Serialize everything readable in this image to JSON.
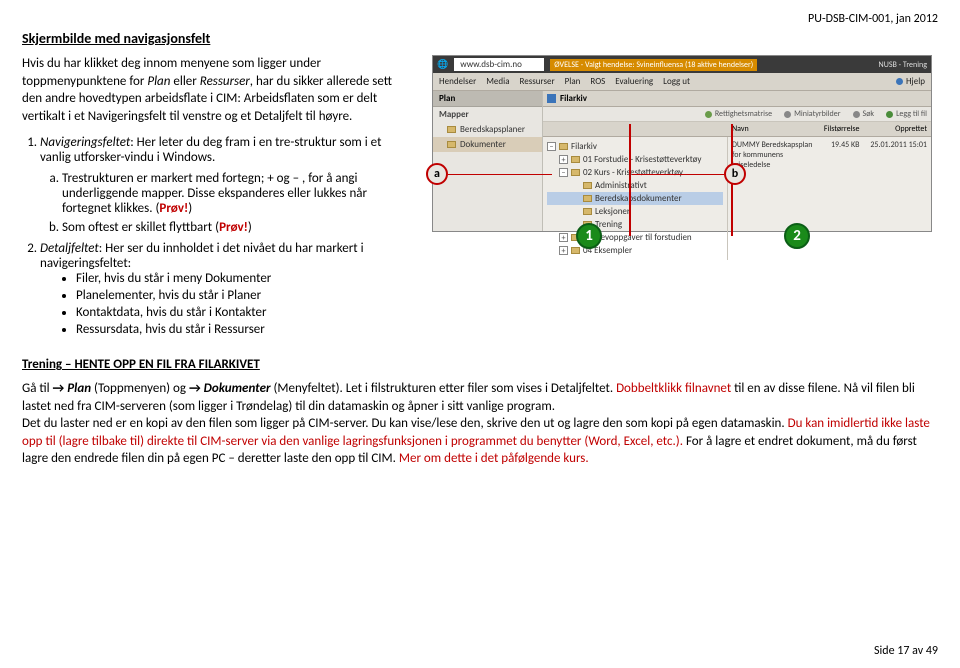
{
  "header": {
    "doc_id": "PU-DSB-CIM-001, jan 2012"
  },
  "section_title": "Skjermbilde med navigasjonsfelt",
  "intro": {
    "p1a": "Hvis du har klikket deg innom menyene som ligger under toppmenypunktene for ",
    "p1_plan": "Plan",
    "p1b": " eller ",
    "p1_ress": "Ressurser",
    "p1c": ", har du sikker allerede sett den andre hovedtypen arbeidsflate i CIM: Arbeidsflaten som er delt vertikalt i et Navigeringsfelt til venstre og et Detaljfelt til høyre."
  },
  "ol1": {
    "lead_i": "Navigeringsfeltet",
    "lead_rest": ": Her leter du deg fram i en tre-struktur som i et vanlig utforsker-vindu i Windows.",
    "a_text": "Trestrukturen er markert med fortegn; + og – , for å angi underliggende mapper. Disse ekspanderes eller lukkes når fortegnet klikkes. (",
    "a_prov": "Prøv!",
    "a_end": ")",
    "b_text": "Som oftest er skillet flyttbart (",
    "b_prov": "Prøv!",
    "b_end": ")"
  },
  "ol2": {
    "lead_i": "Detaljfeltet",
    "lead_rest": ": Her ser du innholdet i det nivået du har markert i navigeringsfeltet:",
    "bullets": {
      "b1": "Filer, hvis du står i meny Dokumenter",
      "b2": "Planelementer, hvis du står i Planer",
      "b3": "Kontaktdata, hvis du står i Kontakter",
      "b4": "Ressursdata, hvis du står i Ressurser"
    }
  },
  "training_title": "Trening – HENTE OPP EN FIL FRA FILARKIVET",
  "bottom": {
    "t1": "Gå til ",
    "arrow": "→",
    "t2": " Plan",
    "t3": " (Toppmenyen) og ",
    "t4": " Dokumenter",
    "t5": " (Menyfeltet). Let i filstrukturen etter filer som vises i Detaljfeltet. ",
    "red1": "Dobbeltklikk filnavnet",
    "t6": " til en av disse filene. ",
    "t7": "Nå vil filen bli lastet ned fra CIM-serveren (som ligger i Trøndelag) til din datamaskin og åpner i sitt vanlige program.",
    "t8": "Det du laster ned er en kopi av den filen som ligger på CIM-server. Du kan vise/lese den, skrive den ut og lagre den som kopi på egen datamaskin. ",
    "red2": "Du kan imidlertid ikke laste opp til (lagre tilbake til) direkte til CIM-server via den vanlige lagringsfunksjonen i programmet du benytter (Word, Excel, etc.).",
    "t9": " For å lagre et endret dokument, må du først lagre den endrede filen din på egen PC – deretter laste den opp til CIM. ",
    "red3": "Mer om dette i det påfølgende kurs."
  },
  "shot": {
    "url": "www.dsb-cim.no",
    "status": "ØVELSE - Valgt hendelse: Svineinfluensa (18 aktive hendelser)",
    "org": "NUSB - Trening",
    "menu": [
      "Hendelser",
      "Media",
      "Ressurser",
      "Plan",
      "ROS",
      "Evaluering",
      "Logg ut"
    ],
    "hjelp": "Hjelp",
    "plan_tab": "Plan",
    "mapper": "Mapper",
    "left_items": [
      "Beredskapsplaner",
      "Dokumenter"
    ],
    "filarkiv": "Filarkiv",
    "toolbar": [
      "Rettighetsmatrise",
      "Miniatyrbilder",
      "Søk",
      "Legg til fil"
    ],
    "col_navn": "Navn",
    "col_stor": "Filstørrelse",
    "col_oppr": "Opprettet",
    "tree": {
      "n0": "Filarkiv",
      "n1": "01 Forstudie - Krisestøtteverktøy",
      "n2": "02 Kurs - Krisestøtteverktøy",
      "n3": "Administrativt",
      "n4": "Beredskapsdokumenter",
      "n5": "Leksjoner",
      "n6": "Trening",
      "n7": "03 Elevoppgaver til forstudien",
      "n8": "04 Eksempler"
    },
    "detail": {
      "name": "DUMMY Beredskapsplan for kommunens kriseledelse",
      "size": "19.45 KB",
      "date": "25.01.2011 15:01"
    }
  },
  "callouts": {
    "a": "a",
    "b": "b",
    "n1": "1",
    "n2": "2"
  },
  "footer": "Side 17 av 49"
}
